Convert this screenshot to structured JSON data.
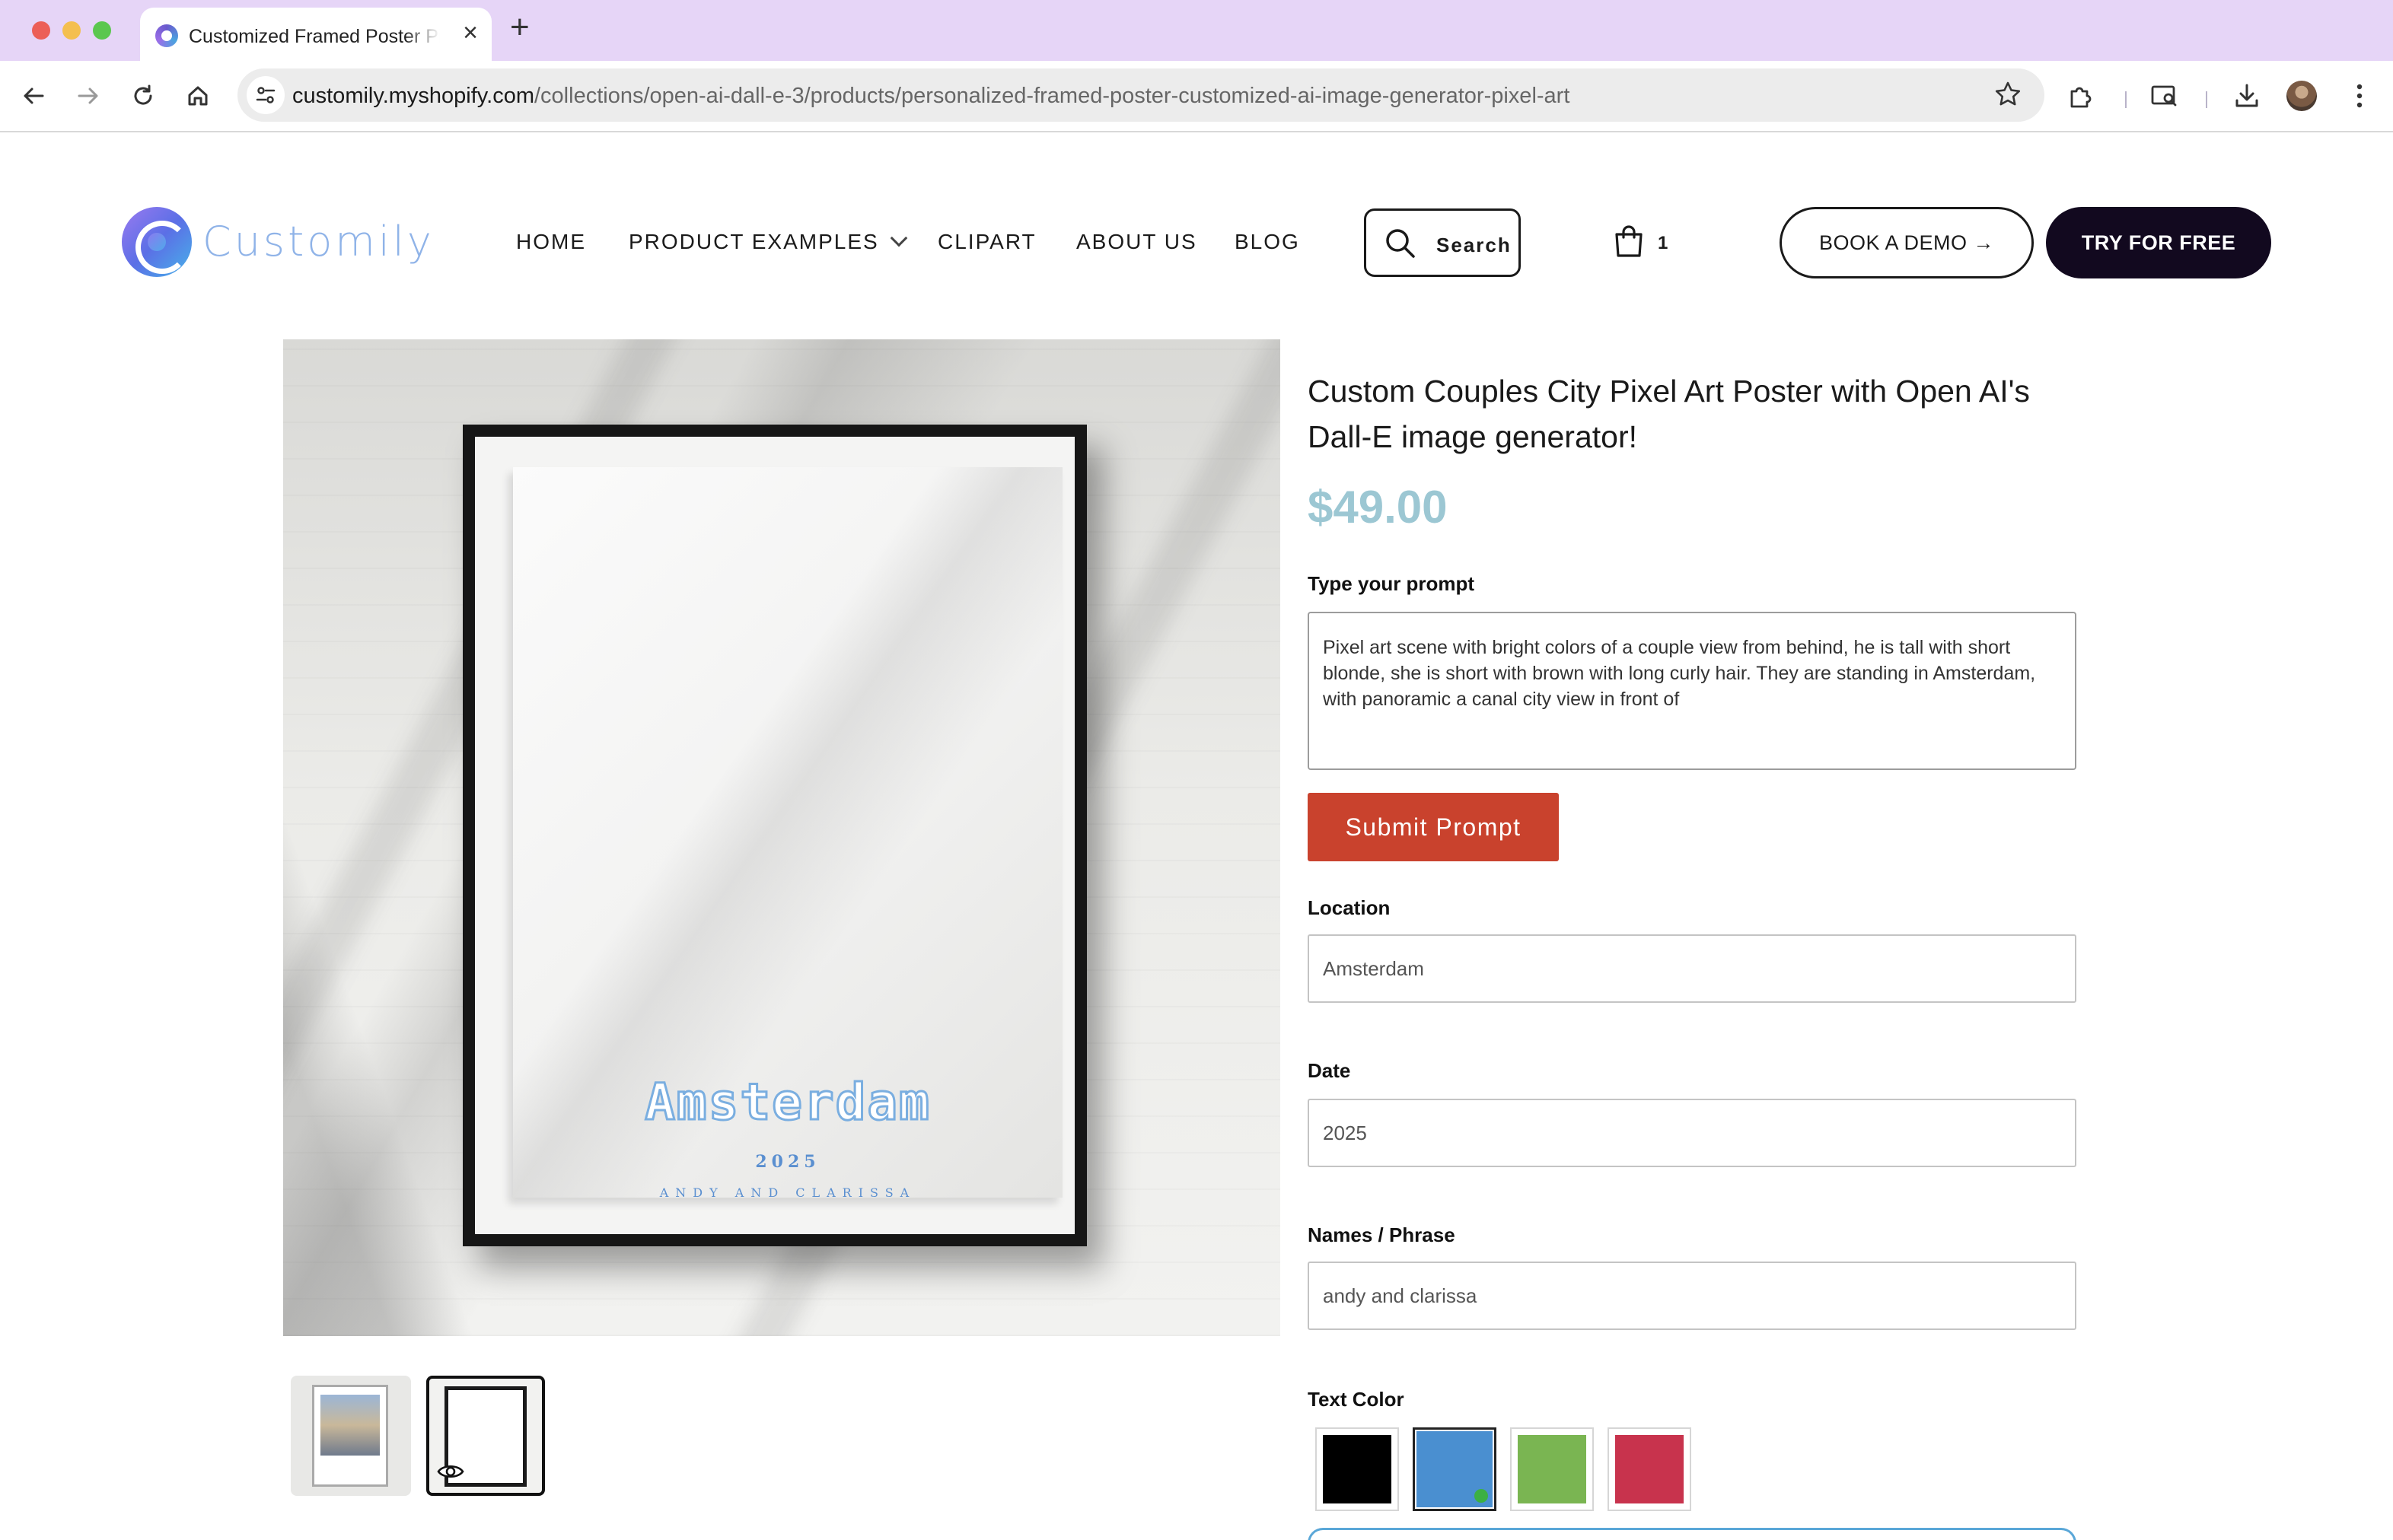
{
  "browser": {
    "tab_title": "Customized Framed Poster Pixel Art",
    "url_host": "customily.myshopify.com",
    "url_path": "/collections/open-ai-dall-e-3/products/personalized-framed-poster-customized-ai-image-generator-pixel-art",
    "icons": [
      "back-arrow-icon",
      "forward-arrow-icon",
      "reload-icon",
      "home-icon",
      "site-settings-icon",
      "star-icon",
      "extensions-icon",
      "tab-search-icon",
      "download-icon",
      "menu-icon"
    ]
  },
  "header": {
    "logo_text": "Customily",
    "nav": {
      "home": "HOME",
      "product_examples": "PRODUCT EXAMPLES",
      "clipart": "CLIPART",
      "about": "ABOUT US",
      "blog": "BLOG"
    },
    "search_label": "Search",
    "cart_count": "1",
    "demo_label": "BOOK A DEMO →",
    "try_label": "TRY FOR FREE"
  },
  "product": {
    "title": "Custom Couples City Pixel Art Poster with Open AI's Dall-E image generator!",
    "price": "$49.00",
    "poster": {
      "city": "Amsterdam",
      "year": "2025",
      "names": "ANDY AND CLARISSA"
    },
    "thumbnails_count": 2
  },
  "form": {
    "prompt_label": "Type your prompt",
    "prompt_value": "Pixel art scene with bright colors of a couple view from behind, he is tall with short blonde, she is short with brown with long curly hair. They are standing in Amsterdam, with panoramic a canal city view in front of",
    "submit_label": "Submit Prompt",
    "location_label": "Location",
    "location_value": "Amsterdam",
    "date_label": "Date",
    "date_value": "2025",
    "names_label": "Names / Phrase",
    "names_value": "andy and clarissa",
    "text_color_label": "Text Color",
    "text_colors": [
      "#000000",
      "#4a8fd0",
      "#7ab552",
      "#c8334d"
    ],
    "selected_color": "#4a8fd0"
  },
  "colors": {
    "accent_button": "#c9422d",
    "price": "#9cc7d3",
    "dark_button": "#12091f",
    "tabbar": "#e6d5f7"
  }
}
